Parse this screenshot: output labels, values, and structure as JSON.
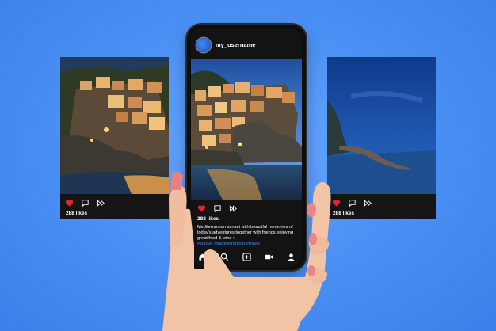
{
  "colors": {
    "background": "#4a90f2",
    "like": "#e0262a",
    "hashtag": "#3f8df0",
    "card": "#151515"
  },
  "phone": {
    "username": "my_username",
    "likes": "288 likes",
    "caption": "Mediterranean sunset with beautiful memories of today's adventures together with friends enjoying great food & wine :)",
    "hashtags": "#sunset #mediterranean #travel",
    "nav_icons": [
      "home-icon",
      "search-icon",
      "add-post-icon",
      "reels-icon",
      "profile-icon"
    ]
  },
  "left_card": {
    "likes": "288 likes"
  },
  "right_card": {
    "likes": "288 likes"
  },
  "icons": [
    "heart-icon",
    "comment-icon",
    "share-icon"
  ]
}
